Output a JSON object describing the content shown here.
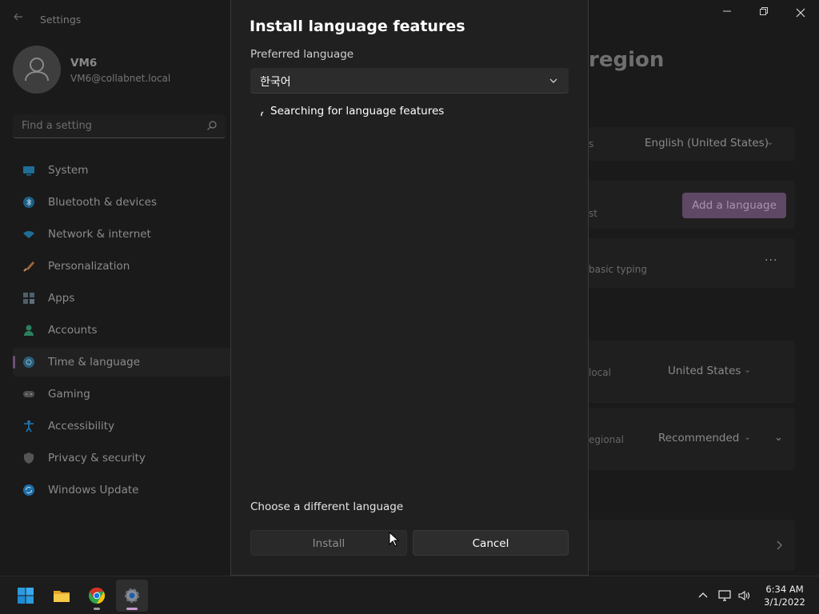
{
  "settings_window": {
    "app_title": "Settings",
    "user": {
      "name": "VM6",
      "email": "VM6@collabnet.local"
    },
    "search": {
      "placeholder": "Find a setting"
    },
    "nav": [
      {
        "label": "System",
        "icon": "system-icon",
        "active": false
      },
      {
        "label": "Bluetooth & devices",
        "icon": "bluetooth-icon",
        "active": false
      },
      {
        "label": "Network & internet",
        "icon": "wifi-icon",
        "active": false
      },
      {
        "label": "Personalization",
        "icon": "brush-icon",
        "active": false
      },
      {
        "label": "Apps",
        "icon": "apps-icon",
        "active": false
      },
      {
        "label": "Accounts",
        "icon": "person-icon",
        "active": false
      },
      {
        "label": "Time & language",
        "icon": "globe-clock-icon",
        "active": true
      },
      {
        "label": "Gaming",
        "icon": "gamepad-icon",
        "active": false
      },
      {
        "label": "Accessibility",
        "icon": "accessibility-icon",
        "active": false
      },
      {
        "label": "Privacy & security",
        "icon": "shield-icon",
        "active": false
      },
      {
        "label": "Windows Update",
        "icon": "update-icon",
        "active": false
      }
    ],
    "page": {
      "heading_partial": "region",
      "display_language_fragment": "s",
      "display_language_value": "English (United States)",
      "preferred_fragment": "st",
      "add_language_label": "Add a language",
      "typing_fragment": "basic typing",
      "more_label": "···",
      "country_fragment": "local",
      "country_value": "United States",
      "format_fragment": "egional",
      "format_value": "Recommended"
    }
  },
  "dialog": {
    "title": "Install language features",
    "preferred_label": "Preferred language",
    "selected_language": "한국어",
    "status": "Searching for language features",
    "different_language_link": "Choose a different language",
    "install_label": "Install",
    "cancel_label": "Cancel"
  },
  "taskbar": {
    "apps": [
      "start-icon",
      "file-explorer-icon",
      "chrome-icon",
      "settings-icon"
    ],
    "time": "6:34 AM",
    "date": "3/1/2022"
  },
  "colors": {
    "accent": "#6b4f73",
    "dialog_bg": "#202020",
    "backdrop": "#1a1a1a"
  }
}
